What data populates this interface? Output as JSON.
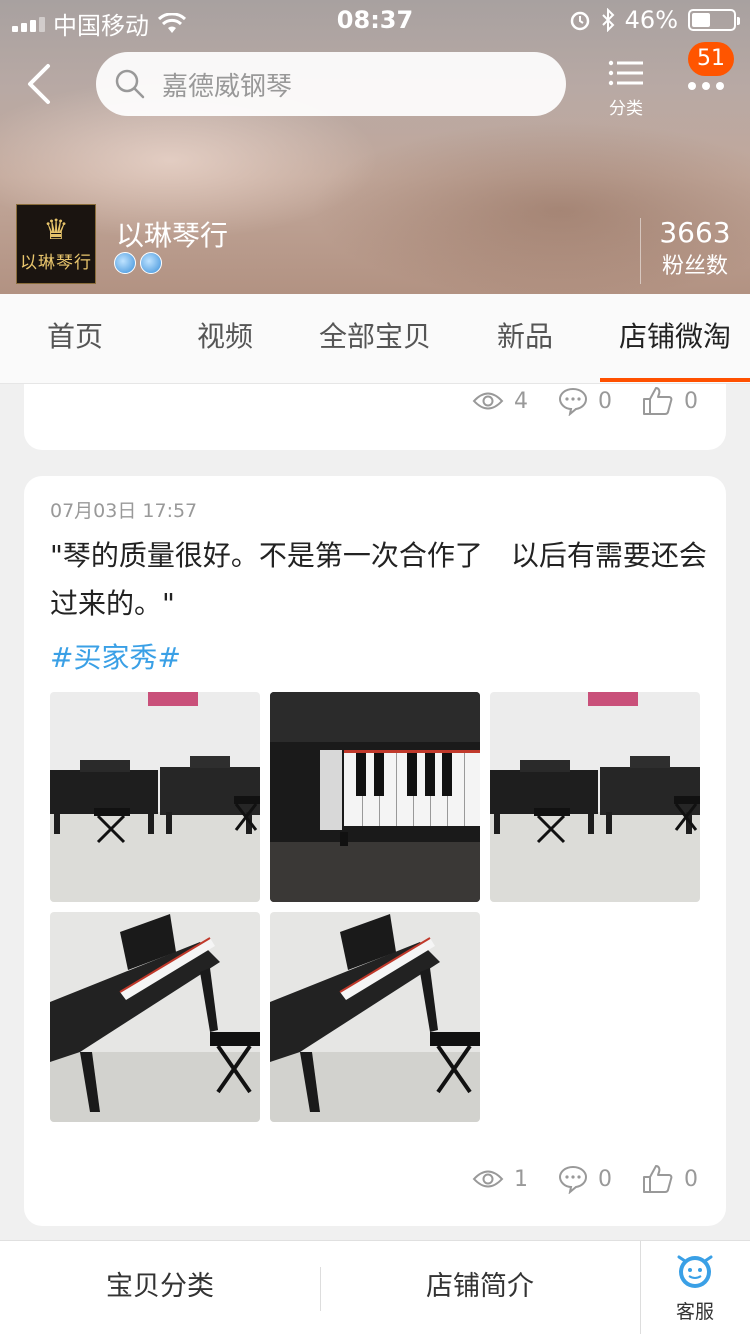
{
  "status_bar": {
    "carrier": "中国移动",
    "time": "08:37",
    "battery_percent_text": "46%",
    "battery_level": 0.46
  },
  "header": {
    "search_placeholder": "嘉德威钢琴",
    "category_label": "分类",
    "notification_count": "51",
    "shop_name": "以琳琴行",
    "logo_text": "以琳琴行",
    "fans_count": "3663",
    "fans_label": "粉丝数"
  },
  "tabs": [
    {
      "label": "首页"
    },
    {
      "label": "视频"
    },
    {
      "label": "全部宝贝"
    },
    {
      "label": "新品"
    },
    {
      "label": "店铺微淘",
      "active": true
    }
  ],
  "previous_post": {
    "views": "4",
    "comments": "0",
    "likes": "0"
  },
  "post": {
    "date": "07月03日 17:57",
    "text": "\"琴的质量很好。不是第一次合作了　以后有需要还会过来的。\"",
    "tag": "#买家秀#",
    "images": [
      {
        "subject": "two-digital-pianos-room"
      },
      {
        "subject": "piano-keys-closeup"
      },
      {
        "subject": "two-digital-pianos-room"
      },
      {
        "subject": "piano-angle-view"
      },
      {
        "subject": "piano-angle-view"
      }
    ],
    "views": "1",
    "comments": "0",
    "likes": "0"
  },
  "bottom_bar": {
    "category": "宝贝分类",
    "intro": "店铺简介",
    "service": "客服"
  },
  "colors": {
    "accent": "#ff5000",
    "tag": "#3aa0e6",
    "badge": "#ff5500"
  }
}
